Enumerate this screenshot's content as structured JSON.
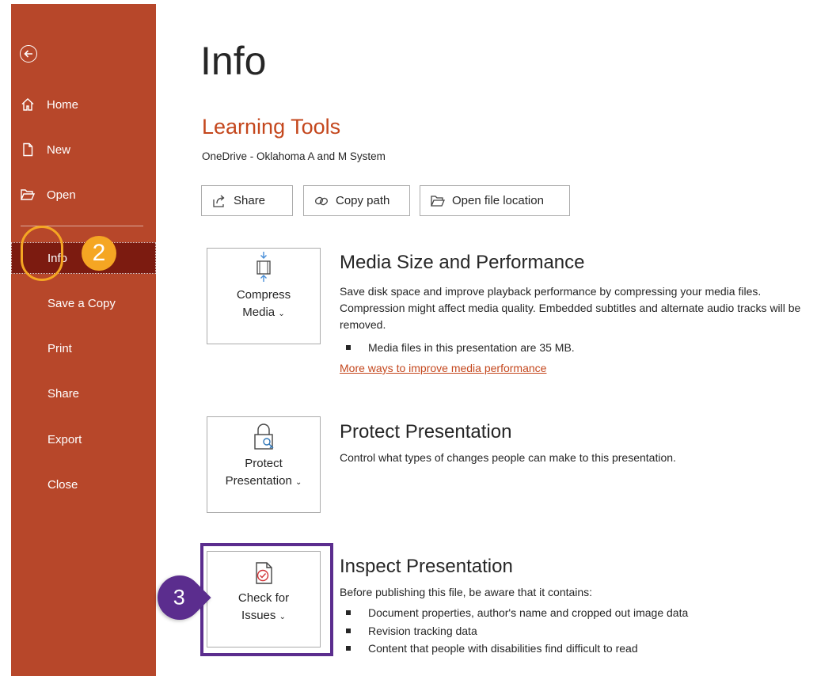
{
  "sidebar": {
    "back_label": "",
    "items": [
      {
        "label": "Home",
        "icon": "home-icon"
      },
      {
        "label": "New",
        "icon": "new-document-icon"
      },
      {
        "label": "Open",
        "icon": "open-folder-icon"
      },
      {
        "label": "Info",
        "selected": true
      },
      {
        "label": "Save a Copy"
      },
      {
        "label": "Print"
      },
      {
        "label": "Share"
      },
      {
        "label": "Export"
      },
      {
        "label": "Close"
      }
    ],
    "color": "#b7472a",
    "selected_color": "#7c1b10"
  },
  "callouts": {
    "step2": "2",
    "step3": "3",
    "step2_color": "#f5a623",
    "step3_color": "#5b2d8e"
  },
  "main": {
    "title": "Info",
    "doc_name": "Learning Tools",
    "doc_location": "OneDrive - Oklahoma A and M System",
    "buttons": {
      "share": "Share",
      "copy_path": "Copy path",
      "open_location": "Open file location"
    },
    "sections": [
      {
        "tile_line1": "Compress",
        "tile_line2": "Media",
        "tile_icon": "compress-media-icon",
        "title": "Media Size and Performance",
        "text": "Save disk space and improve playback performance by compressing your media files. Compression might affect media quality. Embedded subtitles and alternate audio tracks will be removed.",
        "bullets": [
          "Media files in this presentation are 35 MB."
        ],
        "link": "More ways to improve media performance"
      },
      {
        "tile_line1": "Protect",
        "tile_line2": "Presentation",
        "tile_icon": "lock-key-icon",
        "title": "Protect Presentation",
        "text": "Control what types of changes people can make to this presentation."
      },
      {
        "tile_line1": "Check for",
        "tile_line2": "Issues",
        "tile_icon": "check-document-icon",
        "title": "Inspect Presentation",
        "text": "Before publishing this file, be aware that it contains:",
        "bullets": [
          "Document properties, author's name and cropped out image data",
          "Revision tracking data",
          "Content that people with disabilities find difficult to read"
        ]
      }
    ],
    "accent_color": "#c4471d"
  }
}
